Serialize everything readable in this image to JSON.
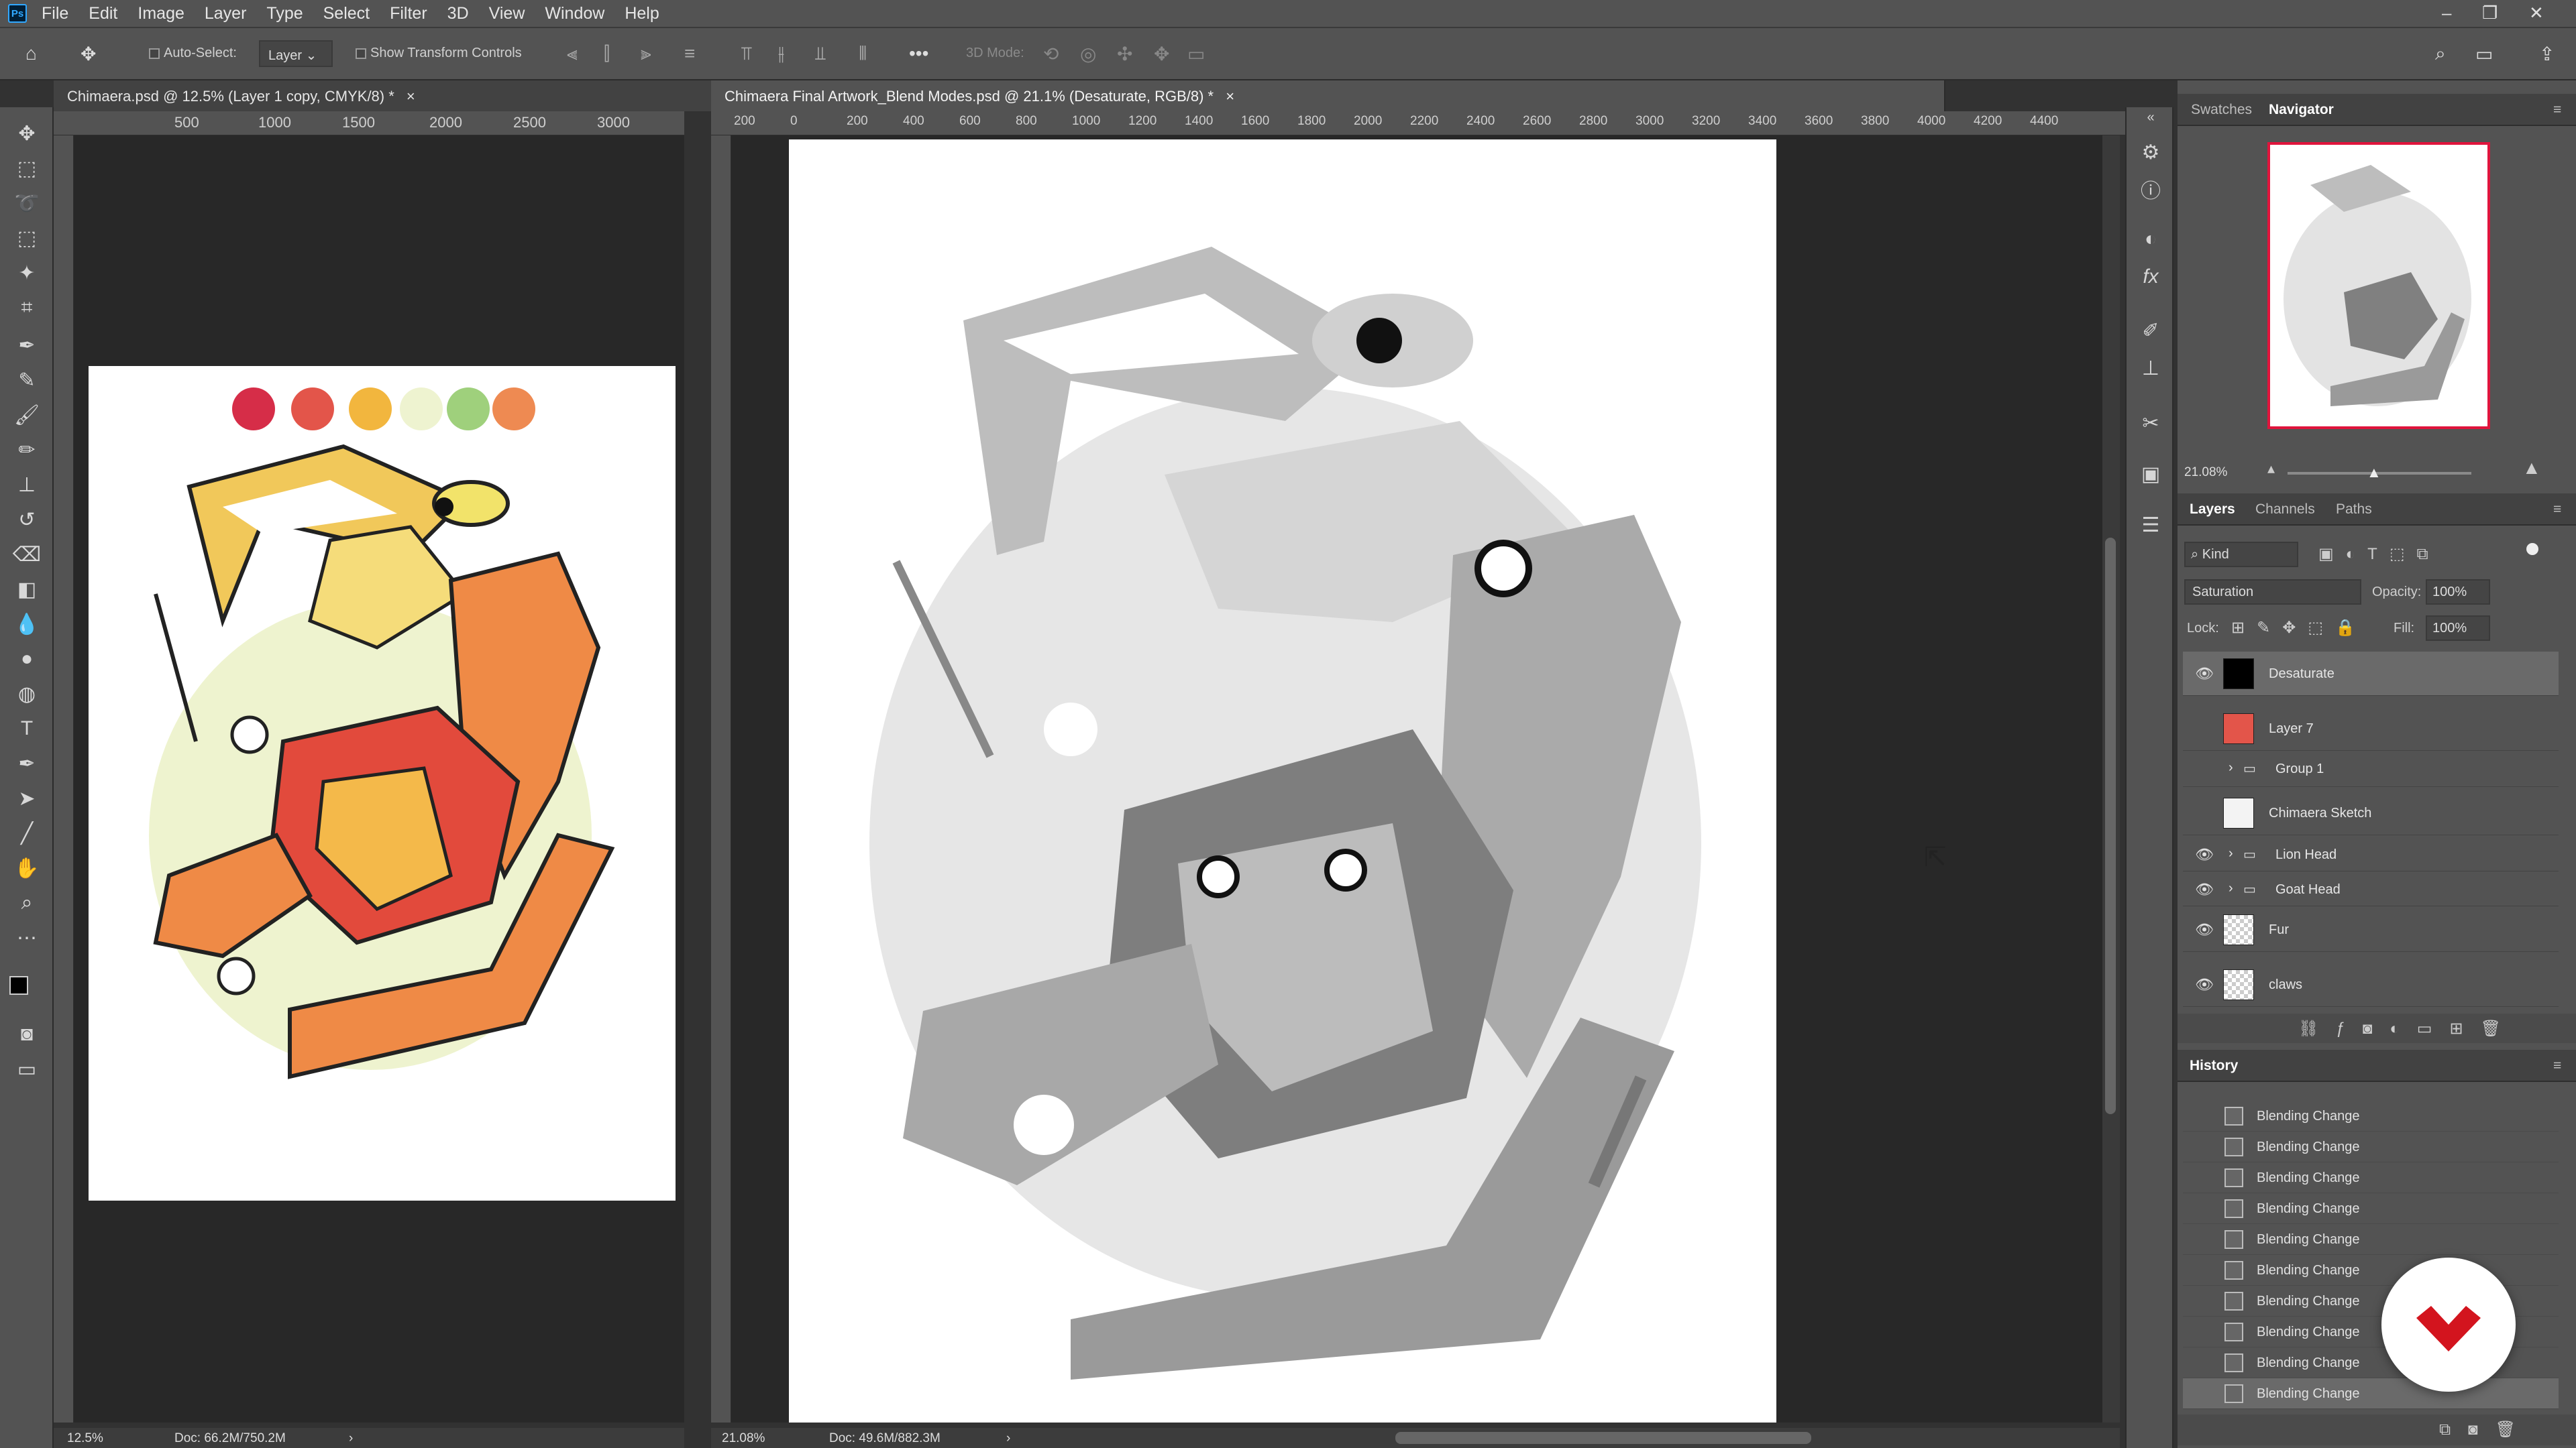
{
  "menubar": {
    "app_icon": "Ps",
    "items": [
      "File",
      "Edit",
      "Image",
      "Layer",
      "Type",
      "Select",
      "Filter",
      "3D",
      "View",
      "Window",
      "Help"
    ]
  },
  "options": {
    "auto_select_label": "Auto-Select:",
    "auto_select_value": "Layer",
    "show_transform_label": "Show Transform Controls",
    "mode_3d_label": "3D Mode:"
  },
  "doc1": {
    "tab": "Chimaera.psd @ 12.5% (Layer 1 copy, CMYK/8) *",
    "ruler": [
      "500",
      "1000",
      "1500",
      "2000",
      "2500",
      "3000"
    ],
    "zoom": "12.5%",
    "doc_size": "Doc: 66.2M/750.2M"
  },
  "doc2": {
    "tab": "Chimaera Final Artwork_Blend Modes.psd @ 21.1% (Desaturate, RGB/8) *",
    "ruler": [
      "200",
      "0",
      "200",
      "400",
      "600",
      "800",
      "1000",
      "1200",
      "1400",
      "1600",
      "1800",
      "2000",
      "2200",
      "2400",
      "2600",
      "2800",
      "3000",
      "3200",
      "3400",
      "3600",
      "3800",
      "4000",
      "4200",
      "4400"
    ],
    "zoom": "21.08%",
    "doc_size": "Doc: 49.6M/882.3M"
  },
  "palette_colors": [
    "#d62d48",
    "#e3554a",
    "#f2b63e",
    "#eef3d0",
    "#9fd07c",
    "#ee8a52"
  ],
  "navigator": {
    "tabs": [
      "Swatches",
      "Navigator"
    ],
    "zoom": "21.08%"
  },
  "layers_panel": {
    "tabs": [
      "Layers",
      "Channels",
      "Paths"
    ],
    "filter": "Kind",
    "blend_mode": "Saturation",
    "opacity_label": "Opacity:",
    "opacity": "100%",
    "lock_label": "Lock:",
    "fill_label": "Fill:",
    "fill": "100%",
    "layers": [
      {
        "name": "Desaturate",
        "visible": true,
        "selected": true
      },
      {
        "name": "Layer 7",
        "visible": false
      },
      {
        "name": "Group 1",
        "visible": false,
        "group": true
      },
      {
        "name": "Chimaera Sketch",
        "visible": false
      },
      {
        "name": "Lion Head",
        "visible": true,
        "group": true
      },
      {
        "name": "Goat Head",
        "visible": true,
        "group": true
      },
      {
        "name": "Fur",
        "visible": true
      },
      {
        "name": "claws",
        "visible": true
      }
    ]
  },
  "history_panel": {
    "title": "History",
    "items": [
      "Blending Change",
      "Blending Change",
      "Blending Change",
      "Blending Change",
      "Blending Change",
      "Blending Change",
      "Blending Change",
      "Blending Change",
      "Blending Change",
      "Blending Change"
    ]
  }
}
